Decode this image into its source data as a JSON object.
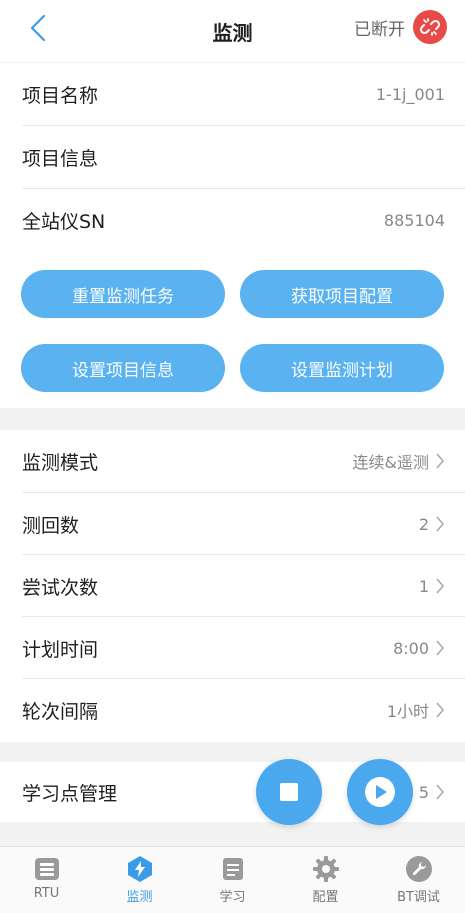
{
  "header": {
    "title": "监测",
    "status_text": "已断开"
  },
  "info_rows": [
    {
      "label": "项目名称",
      "value": "1-1j_001"
    },
    {
      "label": "项目信息",
      "value": ""
    },
    {
      "label": "全站仪SN",
      "value": "885104"
    }
  ],
  "buttons": {
    "reset_task": "重置监测任务",
    "get_config": "获取项目配置",
    "set_info": "设置项目信息",
    "set_plan": "设置监测计划"
  },
  "settings_rows": [
    {
      "label": "监测模式",
      "value": "连续&遥测"
    },
    {
      "label": "测回数",
      "value": "2"
    },
    {
      "label": "尝试次数",
      "value": "1"
    },
    {
      "label": "计划时间",
      "value": "8:00"
    },
    {
      "label": "轮次间隔",
      "value": "1小时"
    }
  ],
  "learning_row": {
    "label": "学习点管理",
    "value": "5"
  },
  "tabs": [
    {
      "label": "RTU",
      "icon": "rtu-icon"
    },
    {
      "label": "监测",
      "icon": "bolt-icon"
    },
    {
      "label": "学习",
      "icon": "scroll-icon"
    },
    {
      "label": "配置",
      "icon": "gear-icon"
    },
    {
      "label": "BT调试",
      "icon": "wrench-icon"
    }
  ],
  "colors": {
    "accent": "#5ab2f0",
    "fab": "#4aa8ee",
    "disconnect": "#e74a47",
    "active_tab": "#3a9be6"
  }
}
